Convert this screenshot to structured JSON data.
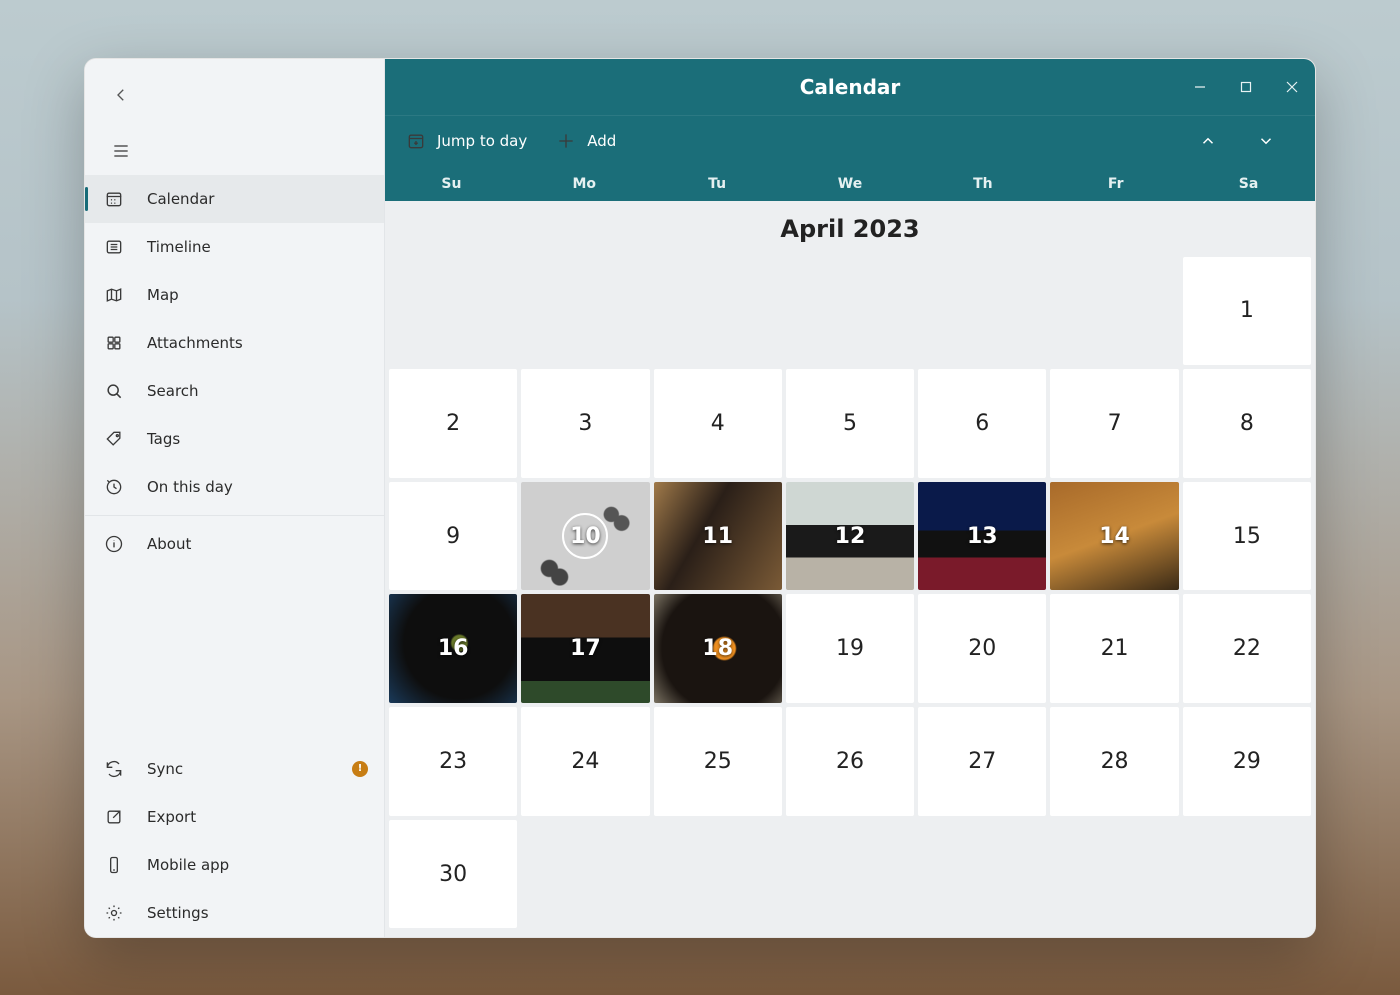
{
  "window": {
    "title": "Calendar"
  },
  "sidebar": {
    "main": [
      {
        "icon": "calendar",
        "label": "Calendar",
        "active": true
      },
      {
        "icon": "timeline",
        "label": "Timeline"
      },
      {
        "icon": "map",
        "label": "Map"
      },
      {
        "icon": "attachments",
        "label": "Attachments"
      },
      {
        "icon": "search",
        "label": "Search"
      },
      {
        "icon": "tags",
        "label": "Tags"
      },
      {
        "icon": "onthisday",
        "label": "On this day"
      }
    ],
    "about": {
      "label": "About"
    },
    "bottom": [
      {
        "icon": "sync",
        "label": "Sync",
        "badge": true
      },
      {
        "icon": "export",
        "label": "Export"
      },
      {
        "icon": "mobile",
        "label": "Mobile app"
      },
      {
        "icon": "settings",
        "label": "Settings"
      }
    ]
  },
  "toolbar": {
    "jump": "Jump to day",
    "add": "Add"
  },
  "weekdays": [
    "Su",
    "Mo",
    "Tu",
    "We",
    "Th",
    "Fr",
    "Sa"
  ],
  "month_label": "April 2023",
  "calendar": {
    "leading_blanks": 6,
    "days": 30,
    "selected": 10,
    "photos": {
      "10": "p10",
      "11": "p11",
      "12": "p12",
      "13": "p13",
      "14": "p14",
      "16": "p16",
      "17": "p17",
      "18": "p18"
    }
  }
}
